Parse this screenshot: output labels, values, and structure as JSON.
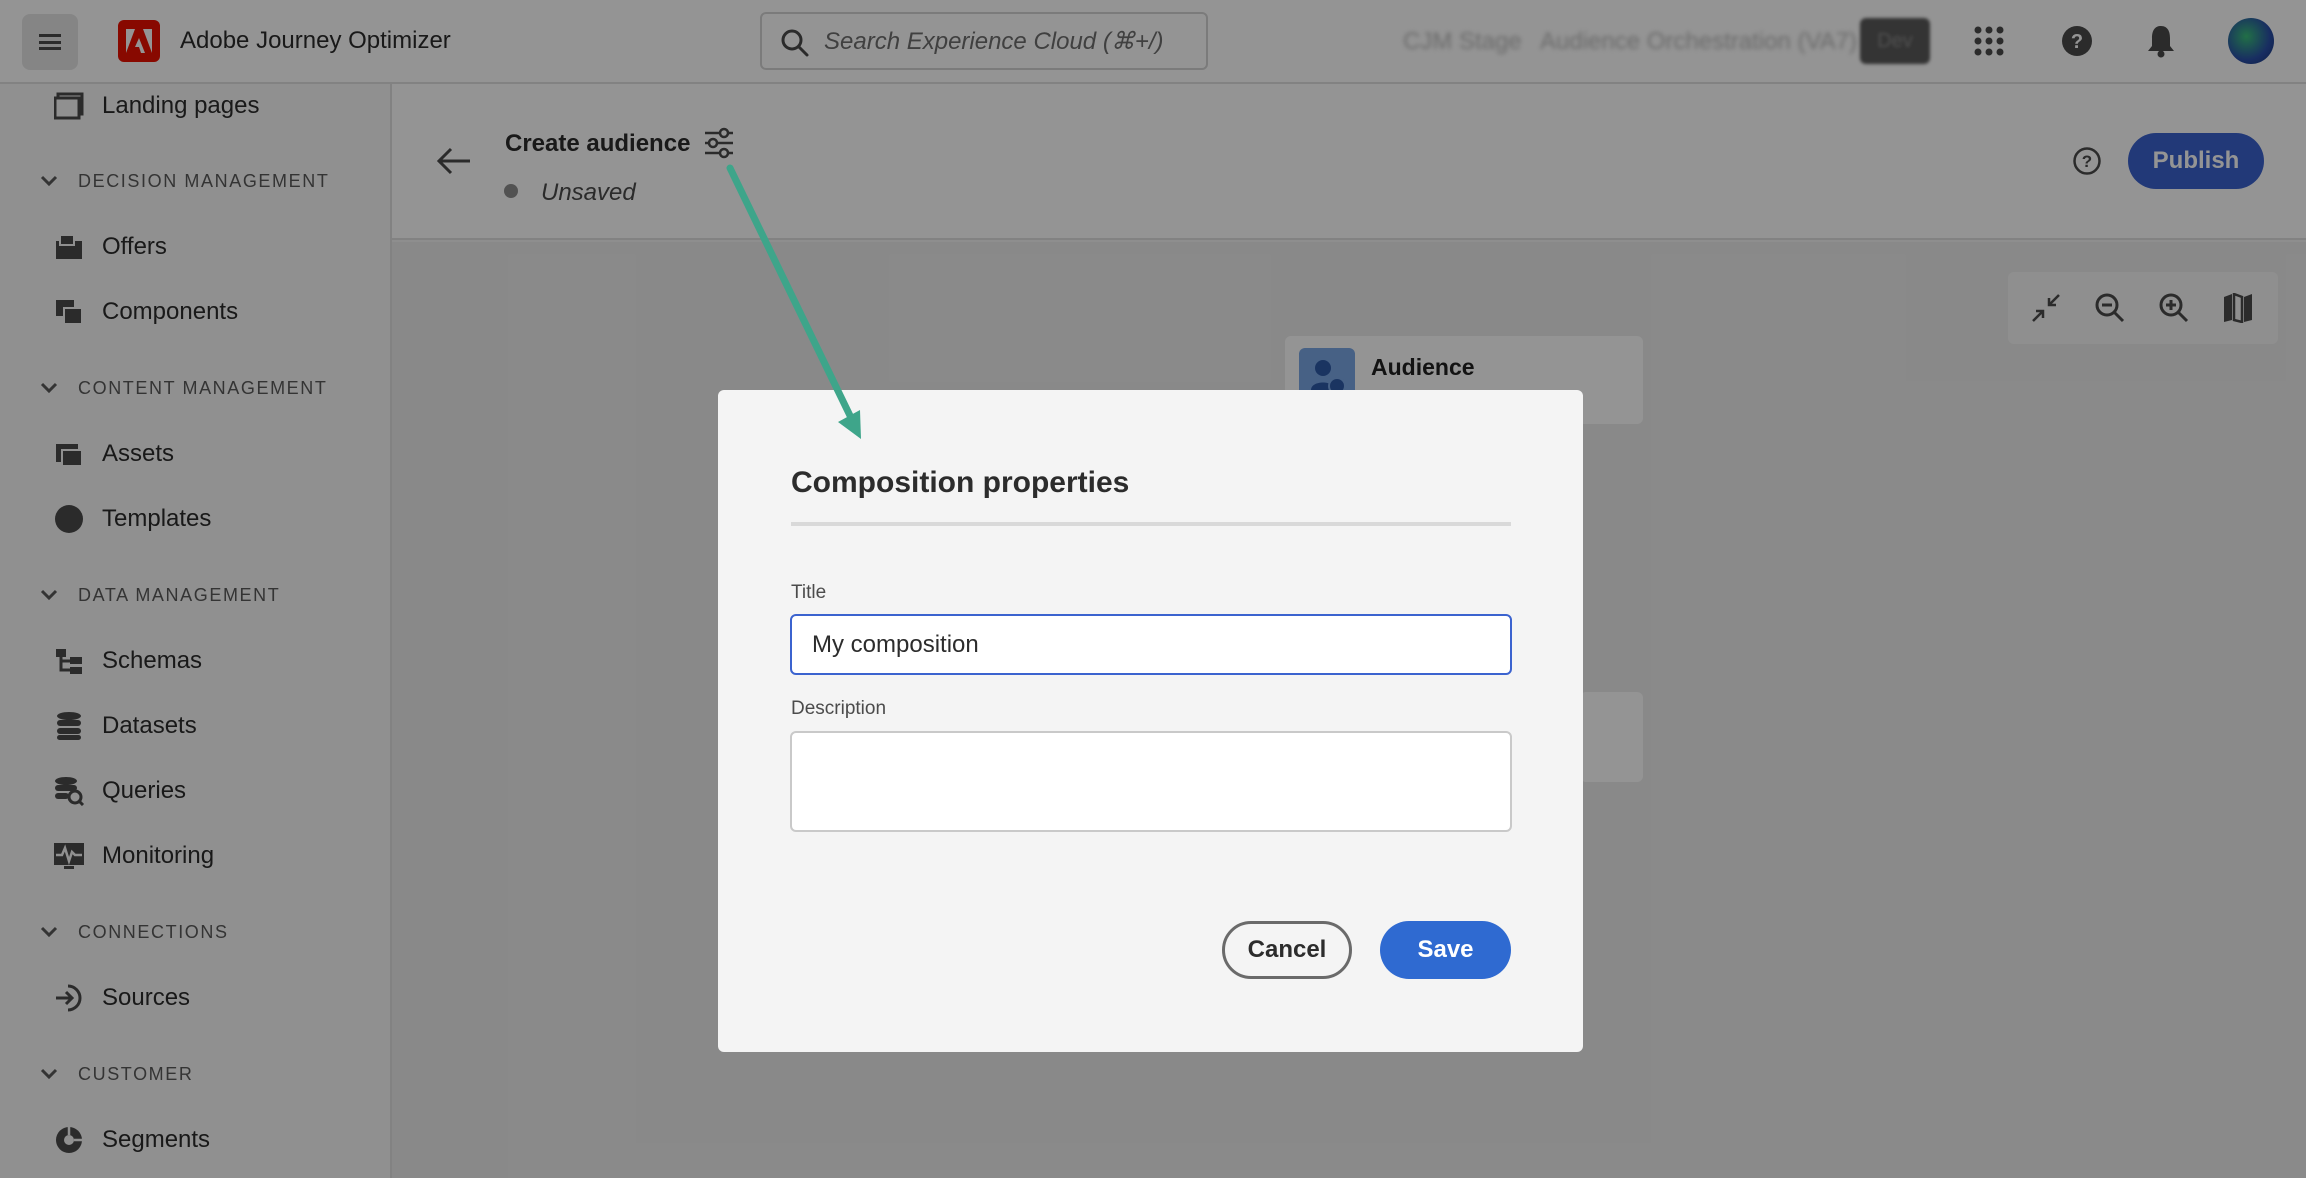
{
  "topbar": {
    "app_title": "Adobe Journey Optimizer",
    "search_placeholder": "Search Experience Cloud (⌘+/)",
    "org_name": "CJM Stage",
    "sandbox_name": "Audience Orchestration (VA7)",
    "env_badge": "Dev",
    "icons": [
      "menu-icon",
      "adobe-logo",
      "search-icon",
      "apps-grid-icon",
      "help-icon",
      "bell-icon",
      "avatar"
    ]
  },
  "sidebar": {
    "items": [
      {
        "label": "Landing pages",
        "icon": "landing-pages-icon"
      },
      {
        "section": "DECISION MANAGEMENT"
      },
      {
        "label": "Offers",
        "icon": "offers-icon"
      },
      {
        "label": "Components",
        "icon": "components-icon"
      },
      {
        "section": "CONTENT MANAGEMENT"
      },
      {
        "label": "Assets",
        "icon": "assets-icon"
      },
      {
        "label": "Templates",
        "icon": "templates-icon"
      },
      {
        "section": "DATA MANAGEMENT"
      },
      {
        "label": "Schemas",
        "icon": "schemas-icon"
      },
      {
        "label": "Datasets",
        "icon": "datasets-icon"
      },
      {
        "label": "Queries",
        "icon": "queries-icon"
      },
      {
        "label": "Monitoring",
        "icon": "monitoring-icon"
      },
      {
        "section": "CONNECTIONS"
      },
      {
        "label": "Sources",
        "icon": "sources-icon"
      },
      {
        "section": "CUSTOMER"
      },
      {
        "label": "Segments",
        "icon": "segments-icon"
      }
    ]
  },
  "header": {
    "title": "Create audience",
    "status": "Unsaved",
    "publish_label": "Publish"
  },
  "canvas": {
    "node_title": "Audience"
  },
  "dialog": {
    "title": "Composition properties",
    "title_label": "Title",
    "title_value": "My composition",
    "description_label": "Description",
    "description_value": "",
    "cancel_label": "Cancel",
    "save_label": "Save"
  },
  "colors": {
    "accent": "#3b63cf",
    "adobe_red": "#eb1000",
    "annotation_arrow": "#3ea58a"
  }
}
